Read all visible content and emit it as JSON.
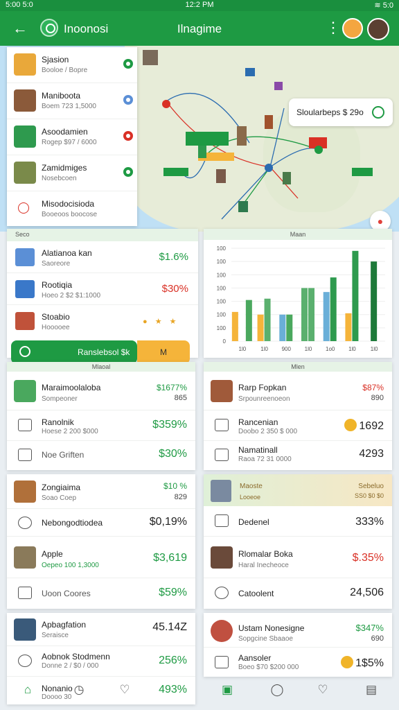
{
  "status_bar": {
    "left": "5:00 5:0",
    "center": "12:2 PM",
    "right": "≋ 5:0"
  },
  "app_bar": {
    "app_title": "Inoonosi",
    "screen_title": "Ilnagime",
    "more_icon": "more-vert-icon"
  },
  "map": {
    "search_chip": "Sloularbeps $ 29o"
  },
  "destinations": [
    {
      "name": "Sjasion",
      "sub": "Booloe / Bopre",
      "thumb_color": "#e9a83a",
      "dot_color": "#1e9a43"
    },
    {
      "name": "Maniboota",
      "sub": "Boem 723 1,5000",
      "thumb_color": "#8b5a3a",
      "dot_color": "#5b8fd6"
    },
    {
      "name": "Asoodamien",
      "sub": "Rogep $97 / 6000",
      "thumb_color": "#2e9a4e",
      "dot_color": "#d93025"
    },
    {
      "name": "Zamidmiges",
      "sub": "Nosebcoen",
      "thumb_color": "#7a8a4a",
      "dot_color": "#1e9a43"
    },
    {
      "name": "Misodocisioda",
      "sub": "Booeoos boocose",
      "thumb_color": "#fff",
      "dot_color": ""
    }
  ],
  "stats": {
    "header": "Seco",
    "rows": [
      {
        "name": "Alatianoa kan",
        "sub": "Saoreore",
        "value": "$1.6%",
        "color": "green",
        "thumb_color": "#5b8fd6"
      },
      {
        "name": "Rootiqia",
        "sub": "Hoeo 2 $2 $1:1000",
        "value": "$30%",
        "color": "red",
        "thumb_color": "#3a78c9"
      },
      {
        "name": "Stoabio",
        "sub": "Hooooee",
        "value": "",
        "color": "dark",
        "thumb_color": "#c0523a"
      }
    ],
    "search_button": "Ranslebsol $k",
    "m_button": "M"
  },
  "chart_data": {
    "type": "bar",
    "title": "Maan",
    "categories": [
      "1l0",
      "1l0",
      "900",
      "1l0",
      "1o0",
      "1l0",
      "1l0"
    ],
    "y_ticks": [
      "100",
      "100",
      "100",
      "100",
      "100",
      "100",
      "100",
      "0"
    ],
    "series": [
      {
        "values": [
          20,
          20,
          20,
          40,
          22,
          40,
          60
        ]
      },
      {
        "values": [
          32,
          0,
          0,
          0,
          37,
          0,
          0
        ]
      },
      {
        "values": [
          0,
          32,
          20,
          0,
          0,
          0,
          0
        ]
      },
      {
        "values": [
          0,
          0,
          0,
          40,
          0,
          0,
          0
        ]
      },
      {
        "values": [
          0,
          0,
          0,
          0,
          45,
          0,
          0
        ]
      },
      {
        "values": [
          0,
          0,
          0,
          0,
          0,
          0,
          0
        ]
      }
    ],
    "bars": [
      {
        "group": 0,
        "values": [
          22,
          23,
          31
        ],
        "colors": [
          "#f5b43a",
          "#ffffff",
          "#4aa85e"
        ]
      },
      {
        "group": 1,
        "values": [
          20,
          32,
          0
        ],
        "colors": [
          "#f5b43a",
          "#5ab06e",
          "#ffffff"
        ]
      },
      {
        "group": 2,
        "values": [
          20,
          20,
          0
        ],
        "colors": [
          "#6aafd8",
          "#4aa85e",
          "#ffffff"
        ]
      },
      {
        "group": 3,
        "values": [
          40,
          40,
          0
        ],
        "colors": [
          "#5ab06e",
          "#5ab06e",
          "#ffffff"
        ]
      },
      {
        "group": 4,
        "values": [
          37,
          48,
          0
        ],
        "colors": [
          "#6aafd8",
          "#2e9a4e",
          "#ffffff"
        ]
      },
      {
        "group": 5,
        "values": [
          21,
          68,
          0
        ],
        "colors": [
          "#f5b43a",
          "#2e9a4e",
          "#ffffff"
        ]
      },
      {
        "group": 6,
        "values": [
          60,
          0,
          0
        ],
        "colors": [
          "#1e7a3a",
          "#ffffff",
          "#ffffff"
        ]
      }
    ],
    "ylim": [
      0,
      70
    ]
  },
  "card_a": {
    "header": "Mlaoal",
    "rows": [
      {
        "name": "Maraimoolaloba",
        "sub": "Sompeoner",
        "value": "$1677%",
        "value2": "865",
        "value_color": "green",
        "thumb_color": "#4aa85e",
        "kind": "thumb"
      },
      {
        "name": "Ranolnik",
        "sub": "Hoese 2 200 $000",
        "value": "$359%",
        "value_color": "green",
        "kind": "icon"
      },
      {
        "name": "Noe Griften",
        "sub": "",
        "value": "$30%",
        "value_color": "green",
        "kind": "icon"
      }
    ]
  },
  "card_b": {
    "header": "Mlen",
    "rows": [
      {
        "name": "Rarp Fopkan",
        "sub": "Srpounreenoeon",
        "value": "$87%",
        "value2": "890",
        "value_color": "red",
        "thumb_color": "#a05a3a",
        "kind": "thumb"
      },
      {
        "name": "Rancenian",
        "sub": "Doobo 2 350 $ 000",
        "value": "1692",
        "value_color": "dark",
        "kind": "icon",
        "coin": true
      },
      {
        "name": "Namatinall",
        "sub": "Raoa 72 31 0000",
        "value": "4293",
        "value_color": "dark",
        "kind": "icon"
      }
    ]
  },
  "card_c": {
    "rows": [
      {
        "name": "Zongiaima",
        "sub": "Soao Coep",
        "value": "$10 %",
        "value2": "829",
        "value_color": "green",
        "thumb_color": "#b0703a",
        "kind": "thumb"
      },
      {
        "name": "Nebongodtiodea",
        "sub": "",
        "value": "$0,19%",
        "value_color": "dark",
        "kind": "icon"
      },
      {
        "name": "Apple",
        "sub": "Oepeo 100 1,3000",
        "value": "$3,619",
        "value_color": "green",
        "thumb_color": "#8a7a5a",
        "kind": "thumb"
      },
      {
        "name": "Uoon Coores",
        "sub": "",
        "value": "$59%",
        "value_color": "green",
        "kind": "icon"
      }
    ]
  },
  "card_d": {
    "banner_left": "Maoste",
    "banner_sub": "Looeoe",
    "banner_right": "Sebeluo",
    "banner_right2": "SS0 $0 $0",
    "rows": [
      {
        "name": "Dedenel",
        "sub": "",
        "value": "333%",
        "value_color": "dark",
        "kind": "icon"
      },
      {
        "name": "Rlomalar Boka",
        "sub": "Haral Inecheoce",
        "value": "$.35%",
        "value_color": "red",
        "thumb_color": "#6a4a3a",
        "kind": "thumb"
      },
      {
        "name": "Catoolent",
        "sub": "",
        "value": "24,506",
        "value_color": "dark",
        "kind": "icon"
      }
    ]
  },
  "card_e": {
    "rows": [
      {
        "name": "Apbagfation",
        "sub": "Seraisce",
        "value": "45.14Z",
        "value_color": "dark",
        "thumb_color": "#3a5a7a",
        "kind": "thumb"
      },
      {
        "name": "Aobnok Stodmenn",
        "sub": "Donne 2 / $0 / 000",
        "value": "256%",
        "value_color": "green",
        "kind": "icon"
      },
      {
        "name": "Nonanio",
        "sub": "Doooo 30",
        "value": "493%",
        "value_color": "green",
        "kind": "icon"
      }
    ]
  },
  "card_f": {
    "rows": [
      {
        "name": "Ustam Nonesigne",
        "sub": "Sopgcine Sbaaoe",
        "value": "$347%",
        "value2": "690",
        "value_color": "green",
        "thumb_color": "#c05040",
        "kind": "thumb"
      },
      {
        "name": "Aansoler",
        "sub": "Boeo $70 $200 000",
        "value": "1$5%",
        "value_color": "dark",
        "kind": "icon",
        "coin": true
      }
    ]
  },
  "bottom_nav": {
    "items": [
      "home-icon",
      "clock-icon",
      "heart-icon",
      "gift-icon",
      "info-icon",
      "heart-icon",
      "list-icon"
    ]
  }
}
